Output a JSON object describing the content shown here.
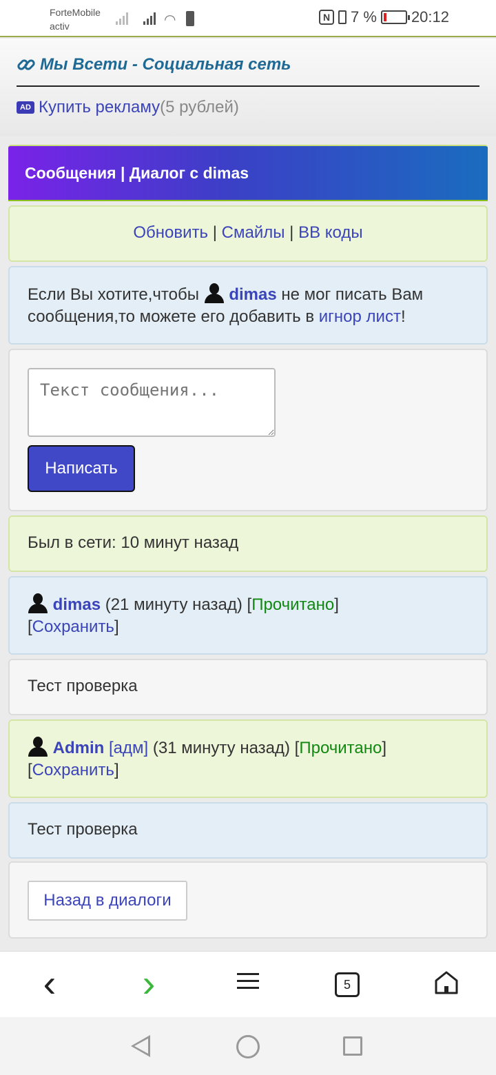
{
  "status_bar": {
    "carrier_line1": "ForteMobile",
    "carrier_line2": "activ",
    "nfc_label": "N",
    "battery_text": "7 %",
    "time": "20:12"
  },
  "header": {
    "site_title": "Мы Всети - Социальная сеть",
    "ad_badge": "AD",
    "ad_link": "Купить рекламу",
    "ad_price": "(5 рублей)"
  },
  "panel": {
    "title": "Сообщения | Диалог с dimas"
  },
  "toolbar": {
    "refresh": "Обновить",
    "sep1": " | ",
    "smiles": "Смайлы",
    "sep2": " | ",
    "bbcodes": "BB коды"
  },
  "ignore_notice": {
    "prefix": "Если Вы хотите,чтобы ",
    "user": "dimas",
    "middle": " не мог писать Вам сообщения,то можете его добавить в ",
    "link": "игнор лист",
    "suffix": "!"
  },
  "compose": {
    "placeholder": "Текст сообщения...",
    "submit": "Написать"
  },
  "last_seen": "Был в сети: 10 минут назад",
  "messages": [
    {
      "author": "dimas",
      "role": "",
      "time": " (21 минуту назад) ",
      "status": "Прочитано",
      "save": "Сохранить",
      "text": "Тест проверка"
    },
    {
      "author": "Admin",
      "role": "[адм]",
      "time": " (31 минуту назад) ",
      "status": "Прочитано",
      "save": "Сохранить",
      "text": "Тест проверка"
    }
  ],
  "back_button": "Назад в диалоги",
  "browser": {
    "back": "‹",
    "forward": "›",
    "tabs_count": "5"
  }
}
